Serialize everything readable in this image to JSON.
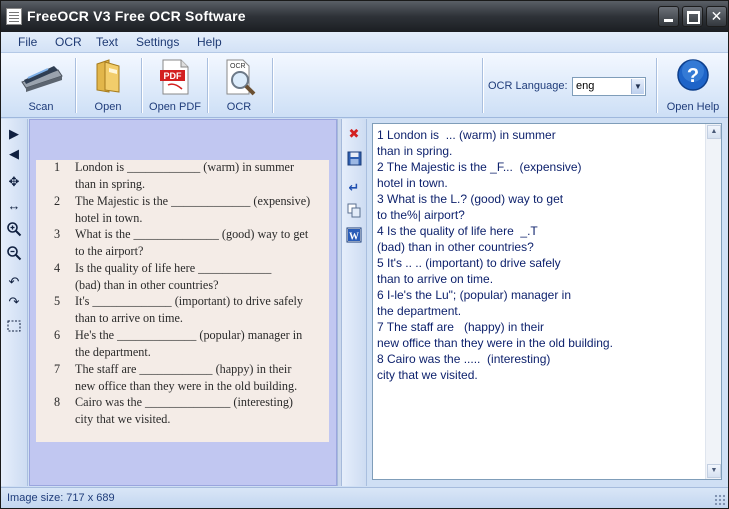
{
  "window": {
    "title": "FreeOCR V3 Free OCR Software"
  },
  "menu": {
    "items": [
      "File",
      "OCR",
      "Text",
      "Settings",
      "Help"
    ]
  },
  "toolbar": {
    "scan_label": "Scan",
    "open_label": "Open",
    "open_pdf_label": "Open PDF",
    "ocr_label": "OCR",
    "ocr_language_label": "OCR Language:",
    "ocr_language_value": "eng",
    "open_help_label": "Open Help",
    "pdf_badge": "PDF",
    "ocr_badge": "OCR"
  },
  "image_page": {
    "items": [
      {
        "num": "1",
        "line1": "London is ____________ (warm) in summer",
        "line2": "than in spring."
      },
      {
        "num": "2",
        "line1": "The Majestic is the _____________ (expensive)",
        "line2": "hotel in town."
      },
      {
        "num": "3",
        "line1": "What is the ______________ (good) way to get",
        "line2": "to the airport?"
      },
      {
        "num": "4",
        "line1": "Is the quality of life here ____________",
        "line2": "(bad) than in other countries?"
      },
      {
        "num": "5",
        "line1": "It's _____________ (important) to drive safely",
        "line2": "than to arrive on time."
      },
      {
        "num": "6",
        "line1": "He's the _____________ (popular) manager in",
        "line2": "the department."
      },
      {
        "num": "7",
        "line1": "The staff are ____________ (happy) in their",
        "line2": "new office than they were in the old building."
      },
      {
        "num": "8",
        "line1": "Cairo was the ______________ (interesting)",
        "line2": "city that we visited."
      }
    ]
  },
  "ocr_output": {
    "text": "1 London is  ... (warm) in summer\nthan in spring.\n2 The Majestic is the _F...  (expensive)\nhotel in town.\n3 What is the L.? (good) way to get\nto the%| airport?\n4 Is the quality of life here  _.T\n(bad) than in other countries?\n5 It's .. .. (important) to drive safely\nthan to arrive on time.\n6 I-le's the Lu\"; (popular) manager in\nthe department.\n7 The staff are   (happy) in their\nnew office than they were in the old building.\n8 Cairo was the .....  (interesting)\ncity that we visited."
  },
  "status": {
    "image_size": "Image size:  717 x  689"
  },
  "colors": {
    "accent": "#1f3c7a",
    "text_output": "#0b1f6b",
    "image_panel_bg": "#c1c7f1"
  }
}
